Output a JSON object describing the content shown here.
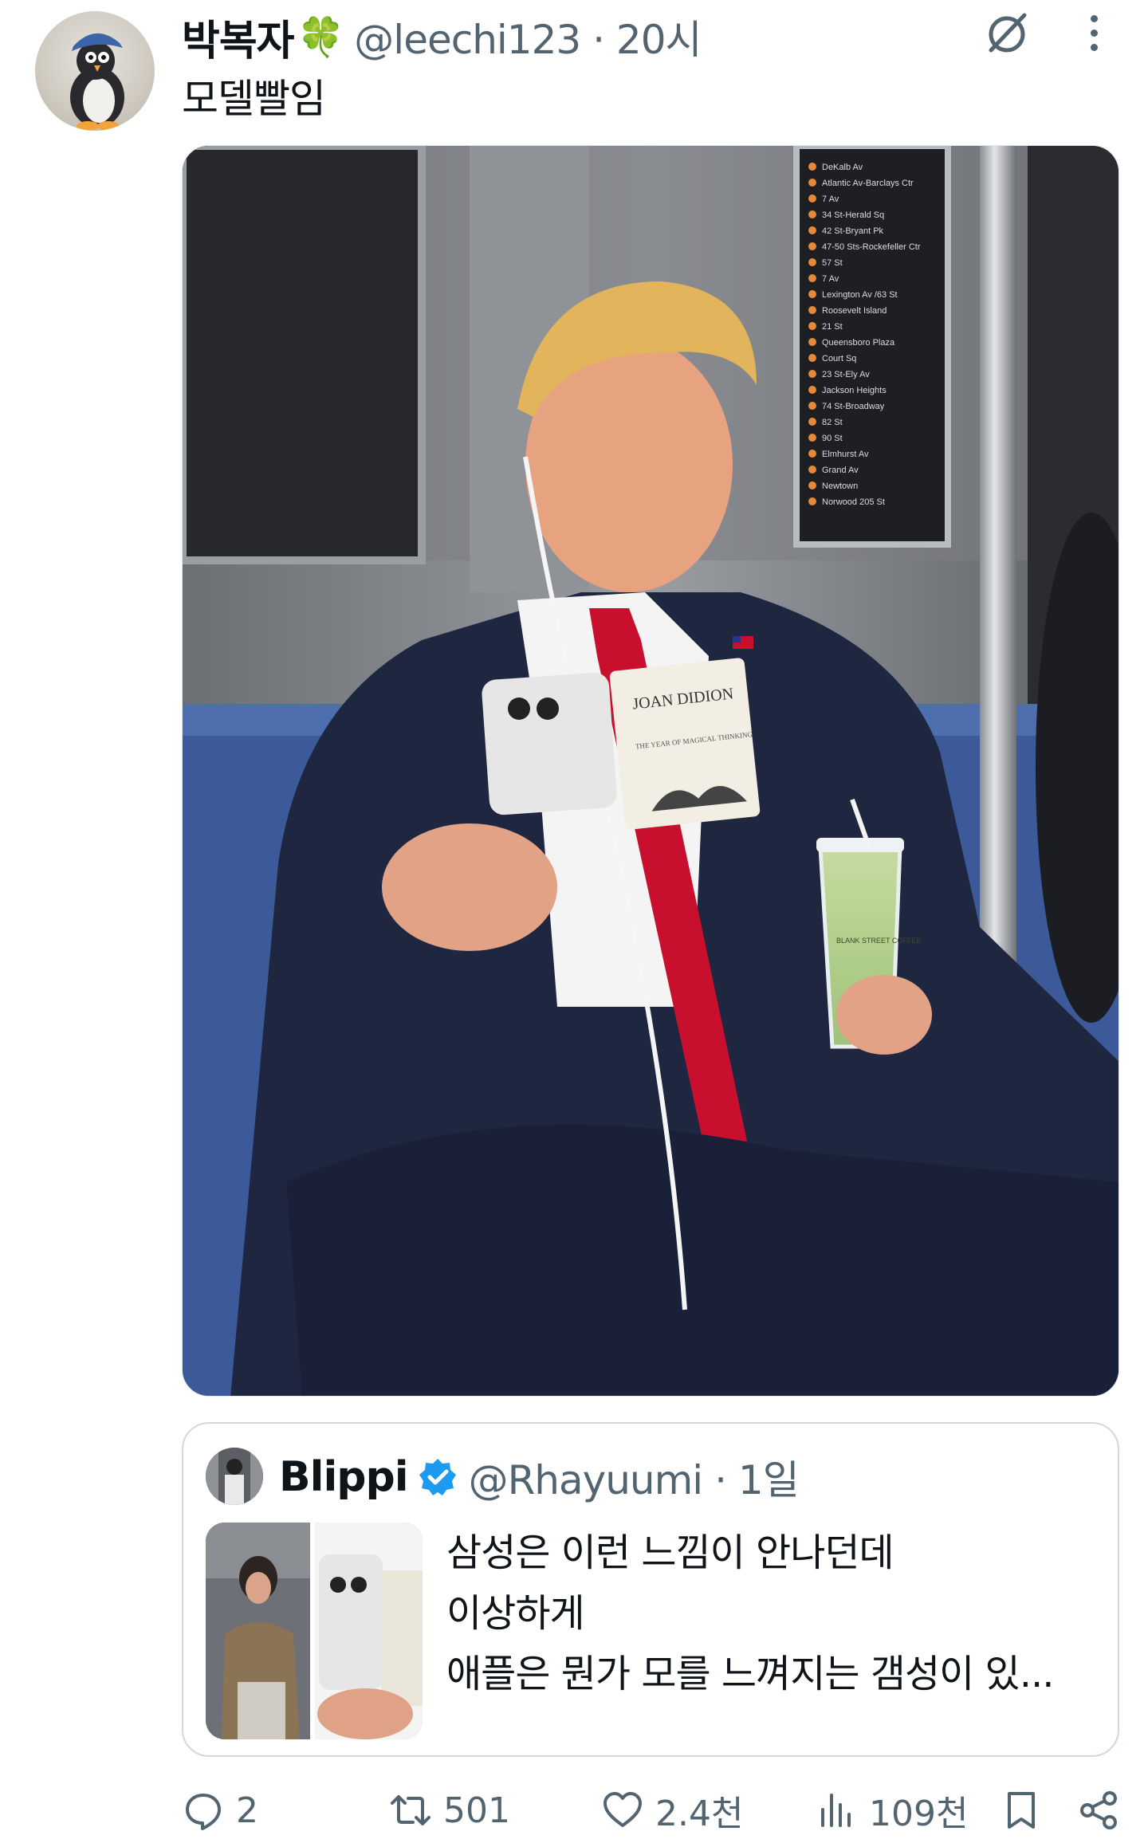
{
  "post": {
    "display_name": "박복자",
    "name_emoji": "🍀",
    "handle_meta": "@leechi123 · 20시",
    "text": "모델빨임",
    "avatar_icon": "penguin-plush-avatar",
    "grok_icon": "grok-icon",
    "more_icon": "more-dots-icon"
  },
  "media": {
    "book_title": "JOAN DIDION",
    "book_subtitle": "THE YEAR OF MAGICAL THINKING",
    "cup_label": "BLANK STREET COFFEE",
    "subway_stops": [
      "DeKalb Av",
      "Atlantic Av-Barclays Ctr",
      "7 Av",
      "34 St-Herald Sq",
      "42 St-Bryant Pk",
      "47-50 Sts-Rockefeller Ctr",
      "57 St",
      "7 Av",
      "Lexington Av /63 St",
      "Roosevelt Island",
      "21 St",
      "Queensboro Plaza",
      "Court Sq",
      "23 St-Ely Av",
      "Jackson Heights",
      "74 St-Broadway",
      "82 St",
      "90 St",
      "Elmhurst Av",
      "Grand Av",
      "Newtown",
      "Norwood 205 St"
    ]
  },
  "quote": {
    "display_name": "Blippi",
    "handle_meta": "@Rhayuumi · 1일",
    "lines": [
      "삼성은 이런 느낌이 안나던데",
      "이상하게",
      "애플은 뭔가 모를 느껴지는 갬성이 있..."
    ],
    "verified_color": "#1d9bf0"
  },
  "actions": {
    "replies": "2",
    "reposts": "501",
    "likes": "2.4천",
    "views": "109천"
  },
  "colors": {
    "text_primary": "#0f1419",
    "text_secondary": "#536471",
    "border": "#cfd9de",
    "tie_red": "#c8102e",
    "suit_navy": "#1f2740"
  }
}
